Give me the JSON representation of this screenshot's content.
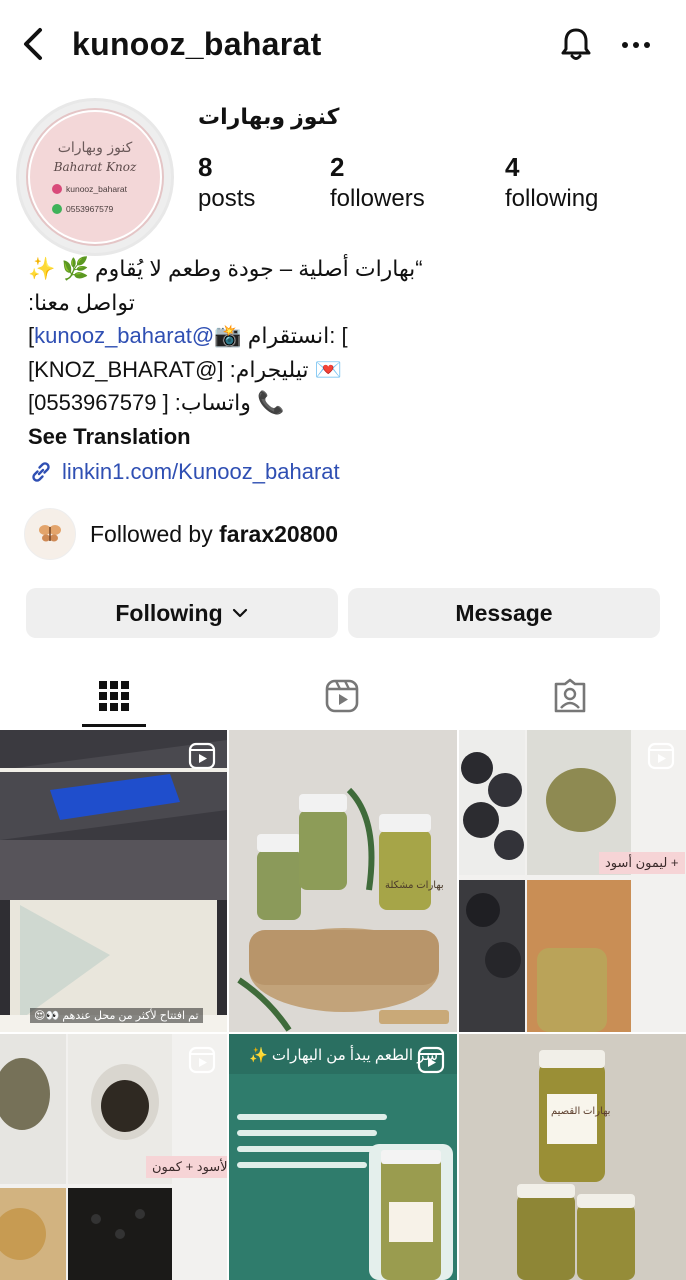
{
  "header": {
    "username": "kunooz_baharat",
    "back_icon": "chevron-left-icon",
    "bell_icon": "bell-icon",
    "more_icon": "ellipsis-icon"
  },
  "avatar": {
    "title": "كنوز وبهارات",
    "subtitle": "Baharat Knoz",
    "instagram": "kunooz_baharat",
    "phone": "0553967579"
  },
  "profile": {
    "display_name": "كنوز وبهارات",
    "stats": [
      {
        "value": "8",
        "label": "posts"
      },
      {
        "value": "2",
        "label": "followers"
      },
      {
        "value": "4",
        "label": "following"
      }
    ]
  },
  "bio": {
    "line1": "“بهارات أصلية – جودة وطعم لا يُقاوم 🌿 ✨",
    "line2": "تواصل معنا:",
    "line3_prefix": "[",
    "line3_link": "kunooz_baharat@",
    "line3_suffix": "] :انستقرام 📸",
    "line4": "[KNOZ_BHARAT@] :تيليجرام 💌",
    "line5": "[0553967579 ] :واتساب 📞",
    "see_translation": "See Translation",
    "website": "linkin1.com/Kunooz_baharat"
  },
  "followed_by": {
    "prefix": "Followed by ",
    "user": "farax20800"
  },
  "buttons": {
    "following": "Following",
    "message": "Message"
  },
  "grid": {
    "cells": [
      {
        "caption": "تم افتتاح لأكثر من محل عندهم 👀😍"
      },
      {
        "caption": "بهارات مشكلة"
      },
      {
        "caption": "+ ليمون أسود"
      },
      {
        "caption": "الأسود + كمون"
      },
      {
        "caption": "سر الطعم يبدأ من البهارات ✨"
      },
      {
        "caption": "بهارات القصيم"
      }
    ]
  },
  "colors": {
    "link": "#2f4fb3",
    "button_bg": "#efefef",
    "avatar_pink": "#f3d7d8"
  }
}
